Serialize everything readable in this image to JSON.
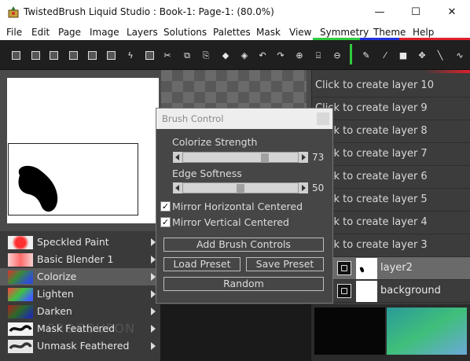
{
  "window": {
    "title": "TwistedBrush Liquid Studio : Book-1: Page-1:  (80.0%)",
    "minimize": "—",
    "maximize": "☐",
    "close": "✕"
  },
  "menu": [
    "File",
    "Edit",
    "Page",
    "Image",
    "Layers",
    "Solutions",
    "Palettes",
    "Mask",
    "View",
    "Symmetry",
    "Theme",
    "Help"
  ],
  "brush_control": {
    "title": "Brush Control",
    "sliders": [
      {
        "label": "Colorize Strength",
        "value": "73",
        "fraction": 0.73
      },
      {
        "label": "Edge Softness",
        "value": "50",
        "fraction": 0.5
      }
    ],
    "checkboxes": [
      {
        "label": "Mirror Horizontal Centered",
        "checked": true
      },
      {
        "label": "Mirror Vertical Centered",
        "checked": true
      }
    ],
    "buttons": {
      "add": "Add Brush Controls",
      "load": "Load Preset",
      "save": "Save Preset",
      "random": "Random"
    },
    "checkmark": "✓"
  },
  "brushes": [
    {
      "label": "Speckled Paint",
      "selected": false
    },
    {
      "label": "Basic Blender 1",
      "selected": false
    },
    {
      "label": "Colorize",
      "selected": true
    },
    {
      "label": "Lighten",
      "selected": false
    },
    {
      "label": "Darken",
      "selected": false
    },
    {
      "label": "Mask Feathered",
      "selected": false
    },
    {
      "label": "Unmask Feathered",
      "selected": false
    }
  ],
  "watermark": "PROCOUPON",
  "layers": {
    "placeholders": [
      "Click to create layer 10",
      "Click to create layer 9",
      "Click to create layer 8",
      "Click to create layer 7",
      "Click to create layer 6",
      "Click to create layer 5",
      "Click to create layer 4",
      "Click to create layer 3"
    ],
    "real": [
      {
        "name": "layer2",
        "active": true
      },
      {
        "name": "background",
        "active": false
      }
    ]
  },
  "colors": {
    "accent_green": "#2ecc40",
    "accent_red": "#e0202a",
    "accent_blue": "#2030e0",
    "selected_row": "#6a6a6a",
    "panel_bg": "#3c3c3c"
  }
}
